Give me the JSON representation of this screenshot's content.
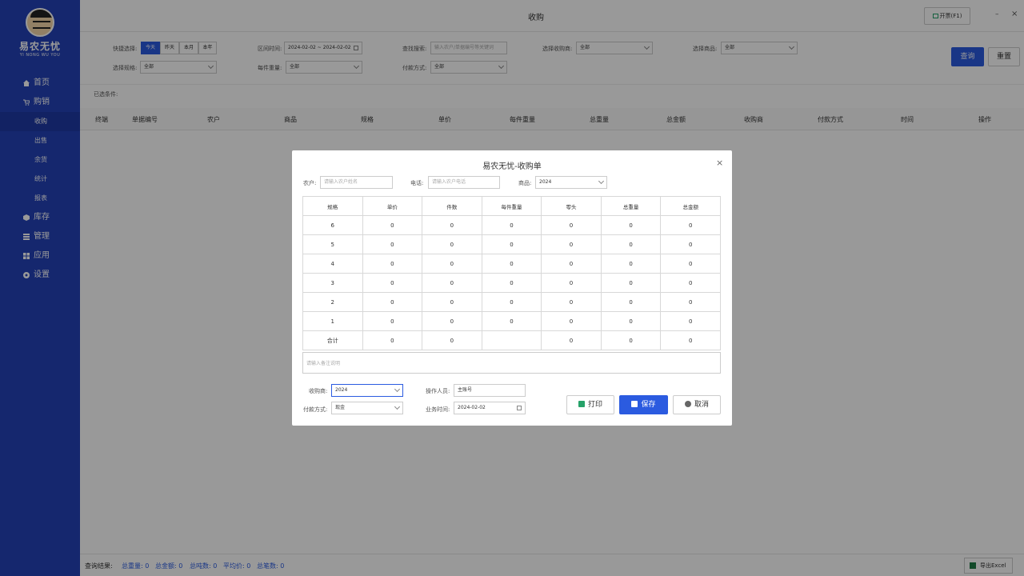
{
  "app": {
    "logo_name": "易农无忧",
    "logo_sub": "YI NONG WU YOU",
    "title": "收购"
  },
  "window": {
    "invoice_button": "开票(F1)",
    "minimize": "–",
    "close": "×"
  },
  "sidebar": {
    "items": [
      {
        "label": "首页",
        "icon": "home-icon"
      },
      {
        "label": "购销",
        "icon": "cart-icon"
      },
      {
        "label": "库存",
        "icon": "box-icon"
      },
      {
        "label": "管理",
        "icon": "list-icon"
      },
      {
        "label": "应用",
        "icon": "grid-icon"
      },
      {
        "label": "设置",
        "icon": "gear-icon"
      }
    ],
    "subitems": [
      "收购",
      "出售",
      "余货",
      "统计",
      "报表"
    ]
  },
  "filters": {
    "quick_label": "快捷选择:",
    "quick_options": [
      "今天",
      "昨天",
      "本月",
      "本年"
    ],
    "range_label": "区间时间:",
    "range_value": "2024-02-02 ~ 2024-02-02",
    "search_label": "查找搜索:",
    "search_placeholder": "输入农户/单据编号等关键词",
    "buyer_label": "选择收购商:",
    "buyer_value": "全部",
    "product_label": "选择商品:",
    "product_value": "全部",
    "spec_label": "选择规格:",
    "spec_value": "全部",
    "weight_label": "每件重量:",
    "weight_value": "全部",
    "pay_label": "付款方式:",
    "pay_value": "全部",
    "query": "查询",
    "reset": "重置",
    "selected_label": "已选条件:"
  },
  "table": {
    "columns": [
      "终端",
      "单据编号",
      "农户",
      "商品",
      "规格",
      "单价",
      "每件重量",
      "总重量",
      "总金额",
      "收购商",
      "付款方式",
      "时间",
      "操作"
    ]
  },
  "footer": {
    "result_label": "查询结果:",
    "total_weight": "总重量: 0",
    "total_amount": "总金额: 0",
    "total_tons": "总吨数: 0",
    "avg_price": "平均价: 0",
    "total_count": "总笔数: 0",
    "export": "导出Excel"
  },
  "modal": {
    "title": "易农无忧-收购单",
    "close": "×",
    "farmer_label": "农户:",
    "farmer_placeholder": "请输入农户姓名",
    "phone_label": "电话:",
    "phone_placeholder": "请输入农户电话",
    "product_label": "商品:",
    "product_value": "2024",
    "grid_headers": [
      "规格",
      "单价",
      "件数",
      "每件重量",
      "零头",
      "总重量",
      "总金额"
    ],
    "grid_rows": [
      [
        "6",
        "0",
        "0",
        "0",
        "0",
        "0",
        "0"
      ],
      [
        "5",
        "0",
        "0",
        "0",
        "0",
        "0",
        "0"
      ],
      [
        "4",
        "0",
        "0",
        "0",
        "0",
        "0",
        "0"
      ],
      [
        "3",
        "0",
        "0",
        "0",
        "0",
        "0",
        "0"
      ],
      [
        "2",
        "0",
        "0",
        "0",
        "0",
        "0",
        "0"
      ],
      [
        "1",
        "0",
        "0",
        "0",
        "0",
        "0",
        "0"
      ],
      [
        "合计",
        "0",
        "0",
        "",
        "0",
        "0",
        "0"
      ]
    ],
    "remark_placeholder": "请输入备注说明",
    "buyer_label": "收购商:",
    "buyer_value": "2024",
    "pay_label": "付款方式:",
    "pay_value": "现金",
    "operator_label": "操作人员:",
    "operator_value": "主账号",
    "biz_time_label": "业务时间:",
    "biz_time_value": "2024-02-02",
    "print": "打印",
    "save": "保存",
    "cancel": "取消"
  },
  "colors": {
    "sidebar": "#2442b8",
    "primary": "#2b5be0",
    "overlay": "rgba(0,0,0,0.4)"
  }
}
